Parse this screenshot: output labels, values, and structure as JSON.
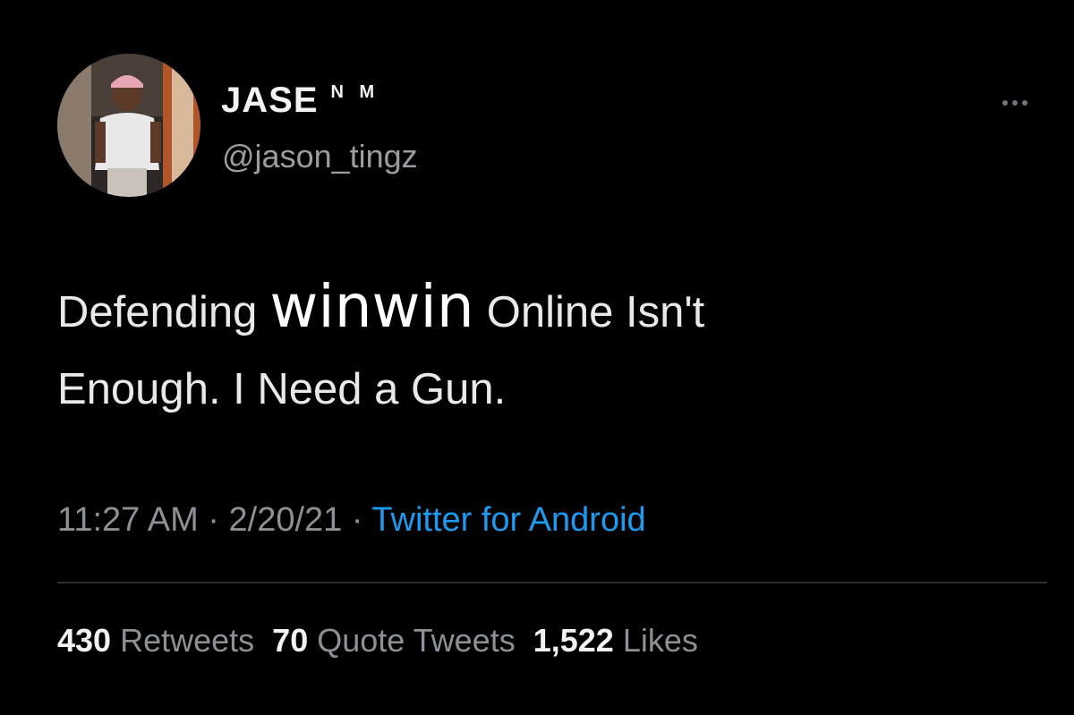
{
  "tweet": {
    "author": {
      "display_name": "JASE",
      "name_suffix": "N M",
      "handle": "@jason_tingz"
    },
    "text": {
      "before_overlay": "Defending",
      "overlay": "winwin",
      "after_overlay": "Online Isn't",
      "line2": "Enough. I Need a Gun."
    },
    "meta": {
      "time": "11:27 AM",
      "separator": "·",
      "date": "2/20/21",
      "source": "Twitter for Android"
    },
    "stats": {
      "retweets_count": "430",
      "retweets_label": "Retweets",
      "quotes_count": "70",
      "quotes_label": "Quote Tweets",
      "likes_count": "1,522",
      "likes_label": "Likes"
    }
  },
  "colors": {
    "background": "#000000",
    "text": "#e7e9ea",
    "secondary": "#8b9196",
    "link": "#1d9bf0"
  },
  "icons": [
    "avatar-photo",
    "more-options-icon"
  ]
}
